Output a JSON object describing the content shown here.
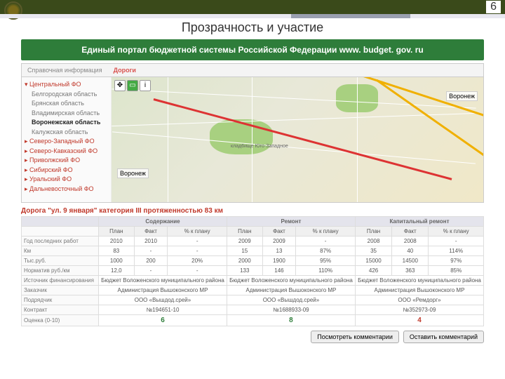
{
  "slide": {
    "page_number": "6",
    "title": "Прозрачность и участие"
  },
  "banner": "Единый портал бюджетной системы Российской Федерации www. budget. gov. ru",
  "tabs": [
    "Справочная информация",
    "Дороги"
  ],
  "active_tab": 1,
  "sidebar": {
    "districts": [
      {
        "name": "Центральный ФО",
        "expanded": true,
        "regions": [
          "Белгородская область",
          "Брянская область",
          "Владимирская область",
          "Воронежская область",
          "Калужская область"
        ],
        "selected": "Воронежская область"
      },
      {
        "name": "Северо-Западный ФО",
        "expanded": false
      },
      {
        "name": "Северо-Кавказский ФО",
        "expanded": false
      },
      {
        "name": "Приволжский ФО",
        "expanded": false
      },
      {
        "name": "Сибирский ФО",
        "expanded": false
      },
      {
        "name": "Уральский ФО",
        "expanded": false
      },
      {
        "name": "Дальневосточный ФО",
        "expanded": false
      }
    ]
  },
  "map": {
    "city_label": "Воронеж",
    "city_label2": "Воронеж",
    "area_label": "клад6ище Юго-Западное"
  },
  "road_title": "Дорога \"ул. 9 января\" категория III протяженностью 83 км",
  "table": {
    "groups": [
      "Содержание",
      "Ремонт",
      "Капитальный ремонт"
    ],
    "cols": [
      "План",
      "Факт",
      "% к плану"
    ],
    "rowlabels": [
      "Год последних работ",
      "Км",
      "Тыс.руб.",
      "Норматив руб./км",
      "Источник финансирования",
      "Заказчик",
      "Подрядчик",
      "Контракт",
      "Оценка (0-10)"
    ],
    "rows": {
      "year": [
        "2010",
        "2010",
        "-",
        "2009",
        "2009",
        "-",
        "2008",
        "2008",
        "-"
      ],
      "km": [
        "83",
        "-",
        "-",
        "15",
        "13",
        "87%",
        "35",
        "40",
        "114%"
      ],
      "thr": [
        "1000",
        "200",
        "20%",
        "2000",
        "1900",
        "95%",
        "15000",
        "14500",
        "97%"
      ],
      "norm": [
        "12,0",
        "-",
        "-",
        "133",
        "146",
        "110%",
        "426",
        "363",
        "85%"
      ],
      "fin": [
        "Бюджет Воложенского муниципального района",
        "Бюджет Воложенского муниципального района",
        "Бюджет Воложенского муниципального района"
      ],
      "cust": [
        "Администрация Вышоконского МР",
        "Администрация Вышоконского МР",
        "Администрация Вышоконского МР"
      ],
      "contr": [
        "ООО «Вышдод.срей»",
        "ООО «Вышдод.срей»",
        "ООО «Ремдорг»"
      ],
      "cntrct": [
        "№194651-10",
        "№1688933-09",
        "№352973-09"
      ],
      "score": [
        "6",
        "8",
        "4"
      ]
    }
  },
  "buttons": {
    "view": "Посмотреть комментарии",
    "leave": "Оставить комментарий"
  }
}
